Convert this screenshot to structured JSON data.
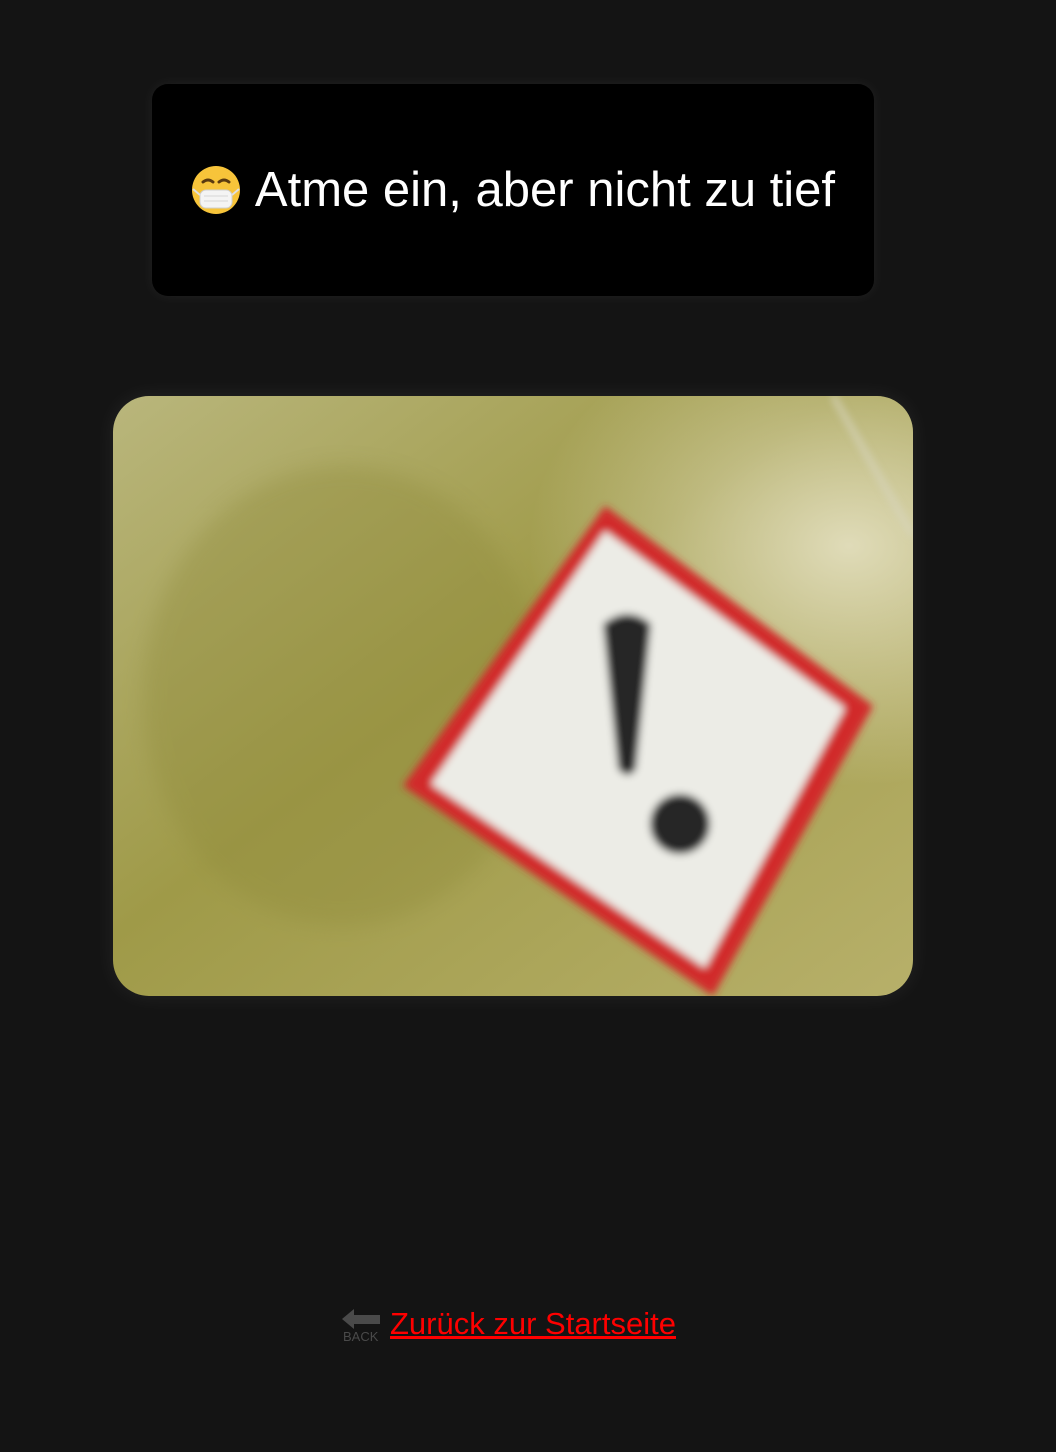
{
  "header": {
    "title": "Atme ein, aber nicht zu tief",
    "icon": "face-with-medical-mask-icon"
  },
  "photo": {
    "subject": "hazard-warning-sign",
    "icon": "exclamation-hazard-icon"
  },
  "footer": {
    "back_link_label": "Zurück zur Startseite",
    "back_icon_label": "BACK",
    "link_color": "#ff0000"
  }
}
